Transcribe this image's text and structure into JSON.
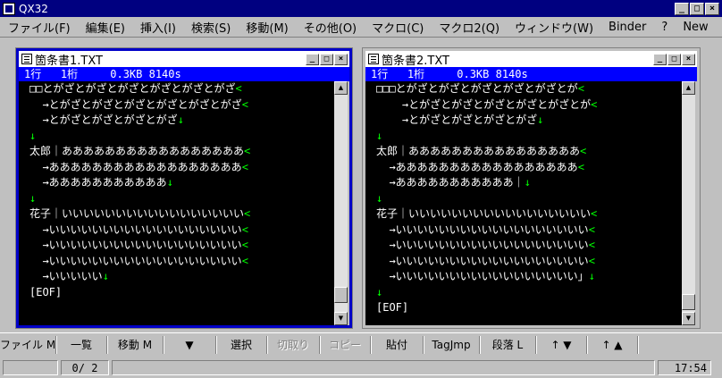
{
  "app": {
    "title": "QX32"
  },
  "window_buttons": {
    "minimize": "_",
    "maximize": "□",
    "close": "×"
  },
  "menu": [
    "ファイル(F)",
    "編集(E)",
    "挿入(I)",
    "検索(S)",
    "移動(M)",
    "その他(O)",
    "マクロ(C)",
    "マクロ2(Q)",
    "ウィンドウ(W)",
    "Binder",
    "?",
    "New"
  ],
  "docs": [
    {
      "title": "箇条書1.TXT",
      "status": "1行   1桁     0.3KB 8140s",
      "lines": [
        {
          "text": "□□とがざとがざとがざとがざとがざとがざ",
          "end": "<"
        },
        {
          "text": "  →とがざとがざとがざとがざとがざとがざ",
          "end": "<"
        },
        {
          "text": "  →とがざとがざとがざとがざ",
          "end": "↓"
        },
        {
          "text": "↓",
          "end": ""
        },
        {
          "text": "太郎｜あああああああああああああああああ",
          "end": "<"
        },
        {
          "text": "  →ああああああああああああああああああ",
          "end": "<"
        },
        {
          "text": "  →あああああああああああ",
          "end": "↓"
        },
        {
          "text": "↓",
          "end": ""
        },
        {
          "text": "花子｜いいいいいいいいいいいいいいいいい",
          "end": "<"
        },
        {
          "text": "  →いいいいいいいいいいいいいいいいいい",
          "end": "<"
        },
        {
          "text": "  →いいいいいいいいいいいいいいいいいい",
          "end": "<"
        },
        {
          "text": "  →いいいいいいいいいいいいいいいいいい",
          "end": "<"
        },
        {
          "text": "  →いいいいい",
          "end": "↓"
        },
        {
          "text": "[EOF]",
          "end": ""
        }
      ]
    },
    {
      "title": "箇条書2.TXT",
      "status": "1行   1桁     0.3KB 8140s",
      "lines": [
        {
          "text": "□□□とがざとがざとがざとがざとがざとが",
          "end": "<"
        },
        {
          "text": "    →とがざとがざとがざとがざとがざとが",
          "end": "<"
        },
        {
          "text": "    →とがざとがざとがざとがざ",
          "end": "↓"
        },
        {
          "text": "↓",
          "end": ""
        },
        {
          "text": "太郎｜ああああああああああああああああ",
          "end": "<"
        },
        {
          "text": "  →あああああああああああああああああ",
          "end": "<"
        },
        {
          "text": "  →あああああああああああ｜",
          "end": "↓"
        },
        {
          "text": "↓",
          "end": ""
        },
        {
          "text": "花子｜いいいいいいいいいいいいいいいいい",
          "end": "<"
        },
        {
          "text": "  →いいいいいいいいいいいいいいいいいい",
          "end": "<"
        },
        {
          "text": "  →いいいいいいいいいいいいいいいいいい",
          "end": "<"
        },
        {
          "text": "  →いいいいいいいいいいいいいいいいいい",
          "end": "<"
        },
        {
          "text": "  →いいいいいいいいいいいいいいいいい」",
          "end": "↓"
        },
        {
          "text": "↓",
          "end": ""
        },
        {
          "text": "[EOF]",
          "end": ""
        }
      ]
    }
  ],
  "function_keys": [
    {
      "label": "ファイル M",
      "disabled": false
    },
    {
      "label": "一覧",
      "disabled": false
    },
    {
      "label": "移動 M",
      "disabled": false
    },
    {
      "label": "▼",
      "disabled": false
    },
    {
      "label": "選択",
      "disabled": false
    },
    {
      "label": "切取り",
      "disabled": true
    },
    {
      "label": "コピー",
      "disabled": true
    },
    {
      "label": "貼付",
      "disabled": false
    },
    {
      "label": "TagJmp",
      "disabled": false
    },
    {
      "label": "段落 L",
      "disabled": false
    },
    {
      "label": "↑ ▼",
      "disabled": false
    },
    {
      "label": "↑ ▲",
      "disabled": false
    }
  ],
  "statusbar": {
    "page": "0/ 2",
    "time": "17:54"
  }
}
